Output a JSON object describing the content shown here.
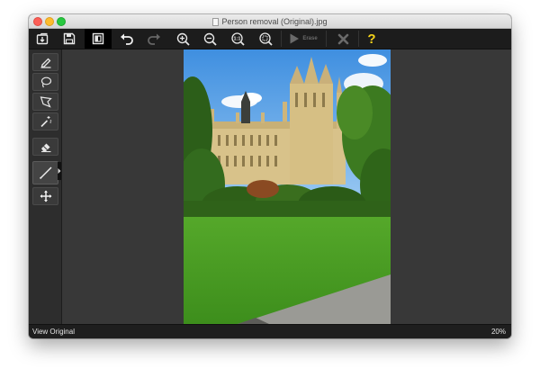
{
  "window": {
    "title": "Person removal (Original).jpg"
  },
  "toolbar": {
    "buttons": [
      {
        "icon": "open-file-icon",
        "enabled": true
      },
      {
        "icon": "save-icon",
        "enabled": true
      },
      {
        "icon": "compare-icon",
        "enabled": true,
        "active": true
      },
      {
        "icon": "undo-icon",
        "enabled": true
      },
      {
        "icon": "redo-icon",
        "enabled": false
      },
      {
        "icon": "zoom-in-icon",
        "enabled": true
      },
      {
        "icon": "zoom-out-icon",
        "enabled": true
      },
      {
        "icon": "actual-size-icon",
        "label": "1:1",
        "enabled": true
      },
      {
        "icon": "fit-screen-icon",
        "enabled": true
      },
      {
        "icon": "play-icon",
        "enabled": false
      },
      {
        "icon": "cancel-icon",
        "enabled": false
      },
      {
        "icon": "help-icon",
        "label": "?",
        "enabled": true
      }
    ],
    "erase_label": "Erase",
    "help_label": "?",
    "actual_size_label": "1:1"
  },
  "sidebar": {
    "tools": [
      {
        "icon": "marker-icon"
      },
      {
        "icon": "lasso-icon"
      },
      {
        "icon": "polygon-lasso-icon"
      },
      {
        "icon": "magic-wand-icon"
      },
      {
        "icon": "eraser-icon"
      },
      {
        "icon": "line-icon",
        "active": true
      },
      {
        "icon": "move-icon"
      }
    ]
  },
  "status": {
    "left": "View Original",
    "zoom": "20%"
  },
  "colors": {
    "toolbar_bg": "#1c1c1c",
    "canvas_bg": "#383838",
    "help_yellow": "#f5d31a"
  }
}
